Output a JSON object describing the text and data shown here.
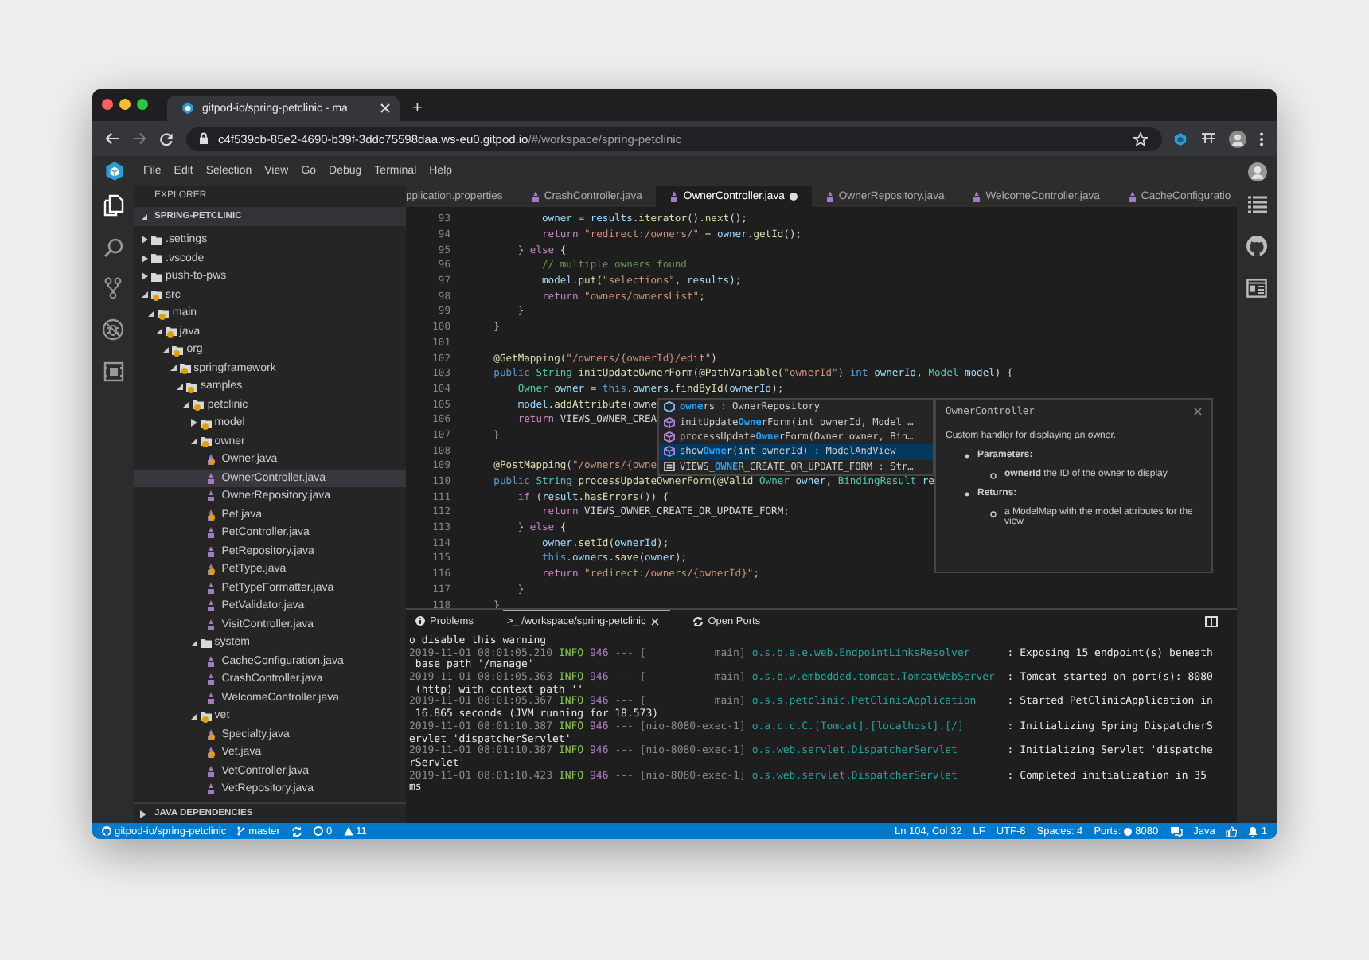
{
  "browser": {
    "tab": {
      "title": "gitpod-io/spring-petclinic - ma"
    },
    "new_tab": "+",
    "url": {
      "host": "c4f539cb-85e2-4690-b39f-3ddc75598daa.ws-eu0.gitpod.io",
      "path": "/#/workspace/spring-petclinic"
    }
  },
  "menu": [
    "File",
    "Edit",
    "Selection",
    "View",
    "Go",
    "Debug",
    "Terminal",
    "Help"
  ],
  "activity_bar": [
    {
      "kind": "files",
      "selected": true
    },
    {
      "kind": "search",
      "selected": false
    },
    {
      "kind": "source-control",
      "selected": false
    },
    {
      "kind": "debug",
      "selected": false
    },
    {
      "kind": "extensions",
      "selected": false
    }
  ],
  "sidebar": {
    "title": "EXPLORER",
    "project": "SPRING-PETCLINIC",
    "tree": [
      {
        "name": ".settings",
        "kind": "folder",
        "expanded": false,
        "warning": false,
        "selected": false
      },
      {
        "name": ".vscode",
        "kind": "folder",
        "expanded": false,
        "warning": false,
        "selected": false
      },
      {
        "name": "push-to-pws",
        "kind": "folder",
        "expanded": false,
        "warning": false,
        "selected": false
      },
      {
        "name": "src",
        "kind": "folder",
        "expanded": true,
        "warning": true,
        "selected": false,
        "children": [
          {
            "name": "main",
            "kind": "folder",
            "expanded": true,
            "warning": true,
            "selected": false,
            "children": [
              {
                "name": "java",
                "kind": "folder",
                "expanded": true,
                "warning": true,
                "selected": false,
                "children": [
                  {
                    "name": "org",
                    "kind": "folder",
                    "expanded": true,
                    "warning": true,
                    "selected": false,
                    "children": [
                      {
                        "name": "springframework",
                        "kind": "folder",
                        "expanded": true,
                        "warning": true,
                        "selected": false,
                        "children": [
                          {
                            "name": "samples",
                            "kind": "folder",
                            "expanded": true,
                            "warning": true,
                            "selected": false,
                            "children": [
                              {
                                "name": "petclinic",
                                "kind": "folder",
                                "expanded": true,
                                "warning": true,
                                "selected": false,
                                "children": [
                                  {
                                    "name": "model",
                                    "kind": "folder",
                                    "expanded": false,
                                    "warning": true,
                                    "selected": false
                                  },
                                  {
                                    "name": "owner",
                                    "kind": "folder",
                                    "expanded": true,
                                    "warning": true,
                                    "selected": false,
                                    "children": [
                                      {
                                        "name": "Owner.java",
                                        "kind": "file",
                                        "warning": true,
                                        "selected": false
                                      },
                                      {
                                        "name": "OwnerController.java",
                                        "kind": "file",
                                        "warning": false,
                                        "selected": true
                                      },
                                      {
                                        "name": "OwnerRepository.java",
                                        "kind": "file",
                                        "warning": false,
                                        "selected": false
                                      },
                                      {
                                        "name": "Pet.java",
                                        "kind": "file",
                                        "warning": true,
                                        "selected": false
                                      },
                                      {
                                        "name": "PetController.java",
                                        "kind": "file",
                                        "warning": false,
                                        "selected": false
                                      },
                                      {
                                        "name": "PetRepository.java",
                                        "kind": "file",
                                        "warning": false,
                                        "selected": false
                                      },
                                      {
                                        "name": "PetType.java",
                                        "kind": "file",
                                        "warning": true,
                                        "selected": false
                                      },
                                      {
                                        "name": "PetTypeFormatter.java",
                                        "kind": "file",
                                        "warning": false,
                                        "selected": false
                                      },
                                      {
                                        "name": "PetValidator.java",
                                        "kind": "file",
                                        "warning": false,
                                        "selected": false
                                      },
                                      {
                                        "name": "VisitController.java",
                                        "kind": "file",
                                        "warning": false,
                                        "selected": false
                                      }
                                    ]
                                  },
                                  {
                                    "name": "system",
                                    "kind": "folder",
                                    "expanded": true,
                                    "warning": false,
                                    "selected": false,
                                    "children": [
                                      {
                                        "name": "CacheConfiguration.java",
                                        "kind": "file",
                                        "warning": false,
                                        "selected": false
                                      },
                                      {
                                        "name": "CrashController.java",
                                        "kind": "file",
                                        "warning": false,
                                        "selected": false
                                      },
                                      {
                                        "name": "WelcomeController.java",
                                        "kind": "file",
                                        "warning": false,
                                        "selected": false
                                      }
                                    ]
                                  },
                                  {
                                    "name": "vet",
                                    "kind": "folder",
                                    "expanded": true,
                                    "warning": true,
                                    "selected": false,
                                    "children": [
                                      {
                                        "name": "Specialty.java",
                                        "kind": "file",
                                        "warning": true,
                                        "selected": false
                                      },
                                      {
                                        "name": "Vet.java",
                                        "kind": "file",
                                        "warning": true,
                                        "selected": false
                                      },
                                      {
                                        "name": "VetController.java",
                                        "kind": "file",
                                        "warning": false,
                                        "selected": false
                                      },
                                      {
                                        "name": "VetRepository.java",
                                        "kind": "file",
                                        "warning": false,
                                        "selected": false
                                      }
                                    ]
                                  }
                                ]
                              }
                            ]
                          }
                        ]
                      }
                    ]
                  }
                ]
              }
            ]
          }
        ]
      }
    ],
    "footer": "JAVA DEPENDENCIES"
  },
  "editor": {
    "tabs": [
      {
        "label": "pplication.properties",
        "java": false,
        "selected": false,
        "modified": false
      },
      {
        "label": "CrashController.java",
        "java": true,
        "selected": false,
        "modified": false
      },
      {
        "label": "OwnerController.java",
        "java": true,
        "selected": true,
        "modified": true
      },
      {
        "label": "OwnerRepository.java",
        "java": true,
        "selected": false,
        "modified": false
      },
      {
        "label": "WelcomeController.java",
        "java": true,
        "selected": false,
        "modified": false
      },
      {
        "label": "CacheConfiguratio",
        "java": true,
        "selected": false,
        "modified": false
      }
    ],
    "lines": [
      {
        "number": "93",
        "tokens": [
          {
            "kind": "variable",
            "text": "            owner"
          },
          {
            "kind": "plain",
            "text": " = "
          },
          {
            "kind": "variable",
            "text": "results"
          },
          {
            "kind": "function",
            "text": ".iterator"
          },
          {
            "kind": "plain",
            "text": "()"
          },
          {
            "kind": "function",
            "text": ".next"
          },
          {
            "kind": "plain",
            "text": "();"
          }
        ]
      },
      {
        "number": "94",
        "tokens": [
          {
            "kind": "control",
            "text": "            return "
          },
          {
            "kind": "string",
            "text": "\"redirect:/owners/\""
          },
          {
            "kind": "plain",
            "text": " + "
          },
          {
            "kind": "variable",
            "text": "owner"
          },
          {
            "kind": "function",
            "text": ".getId"
          },
          {
            "kind": "plain",
            "text": "();"
          }
        ]
      },
      {
        "number": "95",
        "tokens": [
          {
            "kind": "plain",
            "text": "        } "
          },
          {
            "kind": "control",
            "text": "else"
          },
          {
            "kind": "plain",
            "text": " {"
          }
        ]
      },
      {
        "number": "96",
        "tokens": [
          {
            "kind": "comment",
            "text": "            // multiple owners found"
          }
        ]
      },
      {
        "number": "97",
        "tokens": [
          {
            "kind": "variable",
            "text": "            model"
          },
          {
            "kind": "function",
            "text": ".put"
          },
          {
            "kind": "plain",
            "text": "("
          },
          {
            "kind": "string",
            "text": "\"selections\""
          },
          {
            "kind": "plain",
            "text": ", "
          },
          {
            "kind": "variable",
            "text": "results"
          },
          {
            "kind": "plain",
            "text": ");"
          }
        ]
      },
      {
        "number": "98",
        "tokens": [
          {
            "kind": "control",
            "text": "            return "
          },
          {
            "kind": "string",
            "text": "\"owners/ownersList\""
          },
          {
            "kind": "plain",
            "text": ";"
          }
        ]
      },
      {
        "number": "99",
        "tokens": [
          {
            "kind": "plain",
            "text": "        }"
          }
        ]
      },
      {
        "number": "100",
        "tokens": [
          {
            "kind": "plain",
            "text": "    }"
          }
        ]
      },
      {
        "number": "101"
      },
      {
        "number": "102",
        "tokens": [
          {
            "kind": "function",
            "text": "    @GetMapping"
          },
          {
            "kind": "plain",
            "text": "("
          },
          {
            "kind": "string",
            "text": "\"/owners/{ownerId}/edit\""
          },
          {
            "kind": "plain",
            "text": ")"
          }
        ]
      },
      {
        "number": "103",
        "tokens": [
          {
            "kind": "keyword",
            "text": "    public "
          },
          {
            "kind": "type",
            "text": "String "
          },
          {
            "kind": "function",
            "text": "initUpdateOwnerForm"
          },
          {
            "kind": "plain",
            "text": "("
          },
          {
            "kind": "function",
            "text": "@PathVariable"
          },
          {
            "kind": "plain",
            "text": "("
          },
          {
            "kind": "string",
            "text": "\"ownerId\""
          },
          {
            "kind": "plain",
            "text": ") "
          },
          {
            "kind": "keyword",
            "text": "int "
          },
          {
            "kind": "variable",
            "text": "ownerId"
          },
          {
            "kind": "plain",
            "text": ", "
          },
          {
            "kind": "type",
            "text": "Model "
          },
          {
            "kind": "variable",
            "text": "model"
          },
          {
            "kind": "plain",
            "text": ") {"
          }
        ]
      },
      {
        "number": "104",
        "tokens": [
          {
            "kind": "type",
            "text": "        Owner "
          },
          {
            "kind": "variable",
            "text": "owner"
          },
          {
            "kind": "plain",
            "text": " = "
          },
          {
            "kind": "keyword",
            "text": "this"
          },
          {
            "kind": "variable",
            "text": ".owners"
          },
          {
            "kind": "function",
            "text": ".findById"
          },
          {
            "kind": "plain",
            "text": "("
          },
          {
            "kind": "variable",
            "text": "ownerId"
          },
          {
            "kind": "plain",
            "text": ");"
          }
        ]
      },
      {
        "number": "105",
        "tokens": [
          {
            "kind": "variable",
            "text": "        model"
          },
          {
            "kind": "function",
            "text": ".addAttribute"
          },
          {
            "kind": "plain",
            "text": "(owne"
          }
        ]
      },
      {
        "number": "106",
        "tokens": [
          {
            "kind": "control",
            "text": "        return "
          },
          {
            "kind": "plain",
            "text": "VIEWS_OWNER_CREA"
          }
        ]
      },
      {
        "number": "107",
        "tokens": [
          {
            "kind": "plain",
            "text": "    }"
          }
        ]
      },
      {
        "number": "108"
      },
      {
        "number": "109",
        "tokens": [
          {
            "kind": "function",
            "text": "    @PostMapping"
          },
          {
            "kind": "plain",
            "text": "("
          },
          {
            "kind": "string",
            "text": "\"/owners/{owne"
          }
        ]
      },
      {
        "number": "110",
        "tokens": [
          {
            "kind": "keyword",
            "text": "    public "
          },
          {
            "kind": "type",
            "text": "String "
          },
          {
            "kind": "function",
            "text": "processUpdateOwnerForm"
          },
          {
            "kind": "plain",
            "text": "("
          },
          {
            "kind": "function",
            "text": "@Valid "
          },
          {
            "kind": "type",
            "text": "Owner "
          },
          {
            "kind": "variable",
            "text": "owner"
          },
          {
            "kind": "plain",
            "text": ", "
          },
          {
            "kind": "type",
            "text": "BindingResult "
          },
          {
            "kind": "variable",
            "text": "re"
          }
        ]
      },
      {
        "number": "111",
        "tokens": [
          {
            "kind": "control",
            "text": "        if "
          },
          {
            "kind": "plain",
            "text": "("
          },
          {
            "kind": "variable",
            "text": "result"
          },
          {
            "kind": "function",
            "text": ".hasErrors"
          },
          {
            "kind": "plain",
            "text": "()) {"
          }
        ]
      },
      {
        "number": "112",
        "tokens": [
          {
            "kind": "control",
            "text": "            return "
          },
          {
            "kind": "plain",
            "text": "VIEWS_OWNER_CREATE_OR_UPDATE_FORM;"
          }
        ]
      },
      {
        "number": "113",
        "tokens": [
          {
            "kind": "plain",
            "text": "        } "
          },
          {
            "kind": "control",
            "text": "else"
          },
          {
            "kind": "plain",
            "text": " {"
          }
        ]
      },
      {
        "number": "114",
        "tokens": [
          {
            "kind": "variable",
            "text": "            owner"
          },
          {
            "kind": "function",
            "text": ".setId"
          },
          {
            "kind": "plain",
            "text": "("
          },
          {
            "kind": "variable",
            "text": "ownerId"
          },
          {
            "kind": "plain",
            "text": ");"
          }
        ]
      },
      {
        "number": "115",
        "tokens": [
          {
            "kind": "keyword",
            "text": "            this"
          },
          {
            "kind": "variable",
            "text": ".owners"
          },
          {
            "kind": "function",
            "text": ".save"
          },
          {
            "kind": "plain",
            "text": "("
          },
          {
            "kind": "variable",
            "text": "owner"
          },
          {
            "kind": "plain",
            "text": ");"
          }
        ]
      },
      {
        "number": "116",
        "tokens": [
          {
            "kind": "control",
            "text": "            return "
          },
          {
            "kind": "string",
            "text": "\"redirect:/owners/{ownerId}\""
          },
          {
            "kind": "plain",
            "text": ";"
          }
        ]
      },
      {
        "number": "117",
        "tokens": [
          {
            "kind": "plain",
            "text": "        }"
          }
        ]
      },
      {
        "number": "118",
        "tokens": [
          {
            "kind": "plain",
            "text": "    }"
          }
        ]
      }
    ],
    "suggestions": [
      {
        "kind": "field",
        "match": "owne",
        "after": "rs : OwnerRepository",
        "selected": false
      },
      {
        "kind": "method",
        "before": "initUpdate",
        "match": "Owne",
        "after": "rForm(int ownerId, Model …",
        "selected": false
      },
      {
        "kind": "method",
        "before": "processUpdate",
        "match": "Owne",
        "after": "rForm(Owner owner, Bin…",
        "selected": false
      },
      {
        "kind": "method",
        "before": "show",
        "match": "Owne",
        "after": "r(int ownerId) : ModelAndView",
        "selected": true
      },
      {
        "kind": "constant",
        "before": "VIEWS_",
        "match": "OWNE",
        "after": "R_CREATE_OR_UPDATE_FORM : Str…",
        "selected": false
      }
    ],
    "hover": {
      "title": "OwnerController",
      "summary": "Custom handler for displaying an owner.",
      "sections": [
        {
          "heading": "Parameters:",
          "items": [
            "**ownerId** the ID of the owner to display"
          ]
        },
        {
          "heading": "Returns:",
          "items": [
            "a ModelMap with the model attributes for the view"
          ]
        }
      ]
    }
  },
  "panel": {
    "tabs": [
      {
        "kind": "problems",
        "label": "Problems",
        "selected": false
      },
      {
        "kind": "terminal",
        "label": ">_ /workspace/spring-petclinic",
        "selected": true
      },
      {
        "kind": "ports",
        "label": "Open Ports",
        "selected": false
      }
    ],
    "terminal": [
      {
        "kind": "plain",
        "text": "o disable this warning"
      },
      {
        "kind": "log",
        "time": "2019-11-01 08:01:05.210",
        "level": "INFO",
        "pid": "946",
        "sep": "---",
        "thread": "[           main]",
        "logger": "o.s.b.a.e.web.EndpointLinksResolver",
        "message": ": Exposing 15 endpoint(s) beneath"
      },
      {
        "kind": "plain",
        "text": " base path '/manage'"
      },
      {
        "kind": "log",
        "time": "2019-11-01 08:01:05.363",
        "level": "INFO",
        "pid": "946",
        "sep": "---",
        "thread": "[           main]",
        "logger": "o.s.b.w.embedded.tomcat.TomcatWebServer",
        "message": ": Tomcat started on port(s): 8080"
      },
      {
        "kind": "plain",
        "text": " (http) with context path ''"
      },
      {
        "kind": "log",
        "time": "2019-11-01 08:01:05.367",
        "level": "INFO",
        "pid": "946",
        "sep": "---",
        "thread": "[           main]",
        "logger": "o.s.s.petclinic.PetClinicApplication",
        "message": ": Started PetClinicApplication in"
      },
      {
        "kind": "plain",
        "text": " 16.865 seconds (JVM running for 18.573)"
      },
      {
        "kind": "log",
        "time": "2019-11-01 08:01:10.387",
        "level": "INFO",
        "pid": "946",
        "sep": "---",
        "thread": "[nio-8080-exec-1]",
        "logger": "o.a.c.c.C.[Tomcat].[localhost].[/]",
        "message": ": Initializing Spring DispatcherS"
      },
      {
        "kind": "plain",
        "text": "ervlet 'dispatcherServlet'"
      },
      {
        "kind": "log",
        "time": "2019-11-01 08:01:10.387",
        "level": "INFO",
        "pid": "946",
        "sep": "---",
        "thread": "[nio-8080-exec-1]",
        "logger": "o.s.web.servlet.DispatcherServlet",
        "message": ": Initializing Servlet 'dispatche"
      },
      {
        "kind": "plain",
        "text": "rServlet'"
      },
      {
        "kind": "log",
        "time": "2019-11-01 08:01:10.423",
        "level": "INFO",
        "pid": "946",
        "sep": "---",
        "thread": "[nio-8080-exec-1]",
        "logger": "o.s.web.servlet.DispatcherServlet",
        "message": ": Completed initialization in 35"
      },
      {
        "kind": "plain",
        "text": "ms"
      }
    ]
  },
  "right_bar": [
    {
      "kind": "outline"
    },
    {
      "kind": "github"
    },
    {
      "kind": "preview"
    }
  ],
  "status_bar": {
    "left": [
      {
        "kind": "repo",
        "text": "gitpod-io/spring-petclinic"
      },
      {
        "kind": "branch",
        "text": "master"
      },
      {
        "kind": "sync"
      },
      {
        "kind": "errors",
        "text": "0"
      },
      {
        "kind": "warnings",
        "text": "11"
      }
    ],
    "right": [
      {
        "kind": "text",
        "text": "Ln 104, Col 32"
      },
      {
        "kind": "text",
        "text": "LF"
      },
      {
        "kind": "text",
        "text": "UTF-8"
      },
      {
        "kind": "text",
        "text": "Spaces: 4"
      },
      {
        "kind": "ports",
        "text": "Ports:",
        "value": "8080"
      },
      {
        "kind": "chat"
      },
      {
        "kind": "text",
        "text": "Java"
      },
      {
        "kind": "feedback"
      },
      {
        "kind": "bell",
        "text": "1"
      }
    ]
  }
}
